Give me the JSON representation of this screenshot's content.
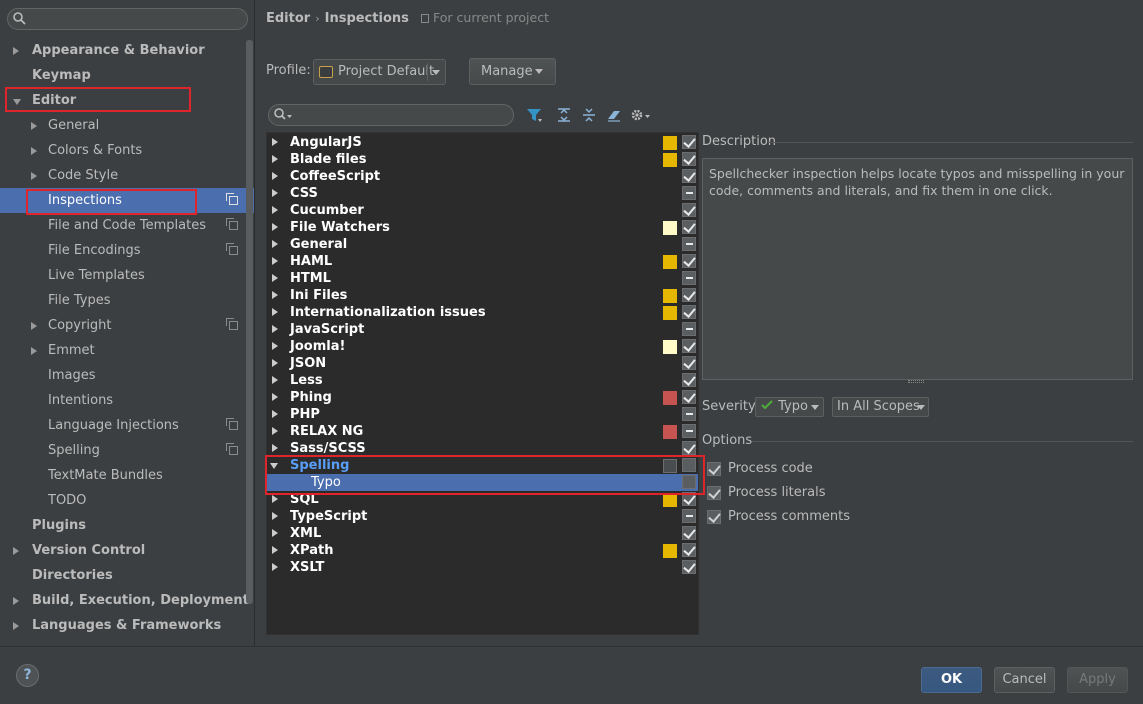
{
  "sidebar": {
    "search_placeholder": "",
    "items": [
      {
        "label": "Appearance & Behavior"
      },
      {
        "label": "Keymap"
      },
      {
        "label": "Editor"
      },
      {
        "label": "General"
      },
      {
        "label": "Colors & Fonts"
      },
      {
        "label": "Code Style"
      },
      {
        "label": "Inspections"
      },
      {
        "label": "File and Code Templates"
      },
      {
        "label": "File Encodings"
      },
      {
        "label": "Live Templates"
      },
      {
        "label": "File Types"
      },
      {
        "label": "Copyright"
      },
      {
        "label": "Emmet"
      },
      {
        "label": "Images"
      },
      {
        "label": "Intentions"
      },
      {
        "label": "Language Injections"
      },
      {
        "label": "Spelling"
      },
      {
        "label": "TextMate Bundles"
      },
      {
        "label": "TODO"
      },
      {
        "label": "Plugins"
      },
      {
        "label": "Version Control"
      },
      {
        "label": "Directories"
      },
      {
        "label": "Build, Execution, Deployment"
      },
      {
        "label": "Languages & Frameworks"
      }
    ]
  },
  "header": {
    "crumb1": "Editor",
    "separator": "›",
    "crumb2": "Inspections",
    "scope_note": "For current project"
  },
  "profile": {
    "label": "Profile:",
    "value": "Project Default",
    "manage_label": "Manage"
  },
  "filter": {
    "placeholder": ""
  },
  "colors": {
    "warning": "#e5b700",
    "weak_warning": "#fffac8",
    "error": "#c75450",
    "none": "#4a4d4f",
    "selection": "#4b6eaf",
    "highlight_box": "#e0242b"
  },
  "inspections": [
    {
      "label": "AngularJS",
      "severity": "warning",
      "check": "checked"
    },
    {
      "label": "Blade files",
      "severity": "warning",
      "check": "checked"
    },
    {
      "label": "CoffeeScript",
      "severity": "",
      "check": "checked"
    },
    {
      "label": "CSS",
      "severity": "",
      "check": "partial"
    },
    {
      "label": "Cucumber",
      "severity": "",
      "check": "checked"
    },
    {
      "label": "File Watchers",
      "severity": "weak_warning",
      "check": "checked"
    },
    {
      "label": "General",
      "severity": "",
      "check": "partial"
    },
    {
      "label": "HAML",
      "severity": "warning",
      "check": "checked"
    },
    {
      "label": "HTML",
      "severity": "",
      "check": "partial"
    },
    {
      "label": "Ini Files",
      "severity": "warning",
      "check": "checked"
    },
    {
      "label": "Internationalization issues",
      "severity": "warning",
      "check": "checked"
    },
    {
      "label": "JavaScript",
      "severity": "",
      "check": "partial"
    },
    {
      "label": "Joomla!",
      "severity": "weak_warning",
      "check": "checked"
    },
    {
      "label": "JSON",
      "severity": "",
      "check": "checked"
    },
    {
      "label": "Less",
      "severity": "",
      "check": "checked"
    },
    {
      "label": "Phing",
      "severity": "error",
      "check": "checked"
    },
    {
      "label": "PHP",
      "severity": "",
      "check": "partial"
    },
    {
      "label": "RELAX NG",
      "severity": "error",
      "check": "partial"
    },
    {
      "label": "Sass/SCSS",
      "severity": "",
      "check": "checked"
    },
    {
      "label": "Spelling",
      "severity": "none",
      "check": "unchecked",
      "expanded": true
    },
    {
      "label": "Typo",
      "severity": "",
      "check": "unchecked",
      "child": true,
      "selected": true
    },
    {
      "label": "SQL",
      "severity": "warning",
      "check": "checked"
    },
    {
      "label": "TypeScript",
      "severity": "",
      "check": "partial"
    },
    {
      "label": "XML",
      "severity": "",
      "check": "checked"
    },
    {
      "label": "XPath",
      "severity": "warning",
      "check": "checked"
    },
    {
      "label": "XSLT",
      "severity": "",
      "check": "checked"
    }
  ],
  "details": {
    "description_title": "Description",
    "description_text": "Spellchecker inspection helps locate typos and misspelling in your code, comments and literals, and fix them in one click.",
    "severity_label": "Severity:",
    "severity_value": "Typo",
    "scope_value": "In All Scopes",
    "options_title": "Options",
    "options": [
      {
        "label": "Process code",
        "checked": true
      },
      {
        "label": "Process literals",
        "checked": true
      },
      {
        "label": "Process comments",
        "checked": true
      }
    ]
  },
  "footer": {
    "help": "?",
    "ok": "OK",
    "cancel": "Cancel",
    "apply": "Apply"
  }
}
